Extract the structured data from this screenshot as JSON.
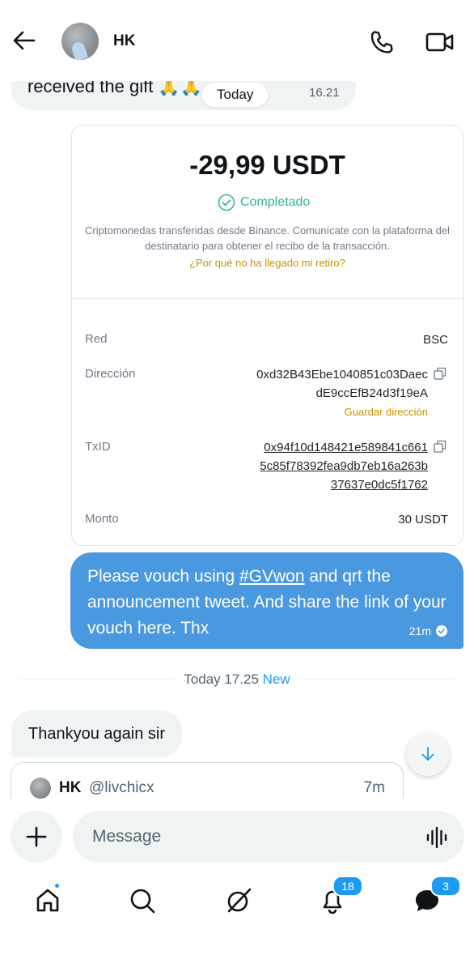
{
  "header": {
    "contact_name": "HK"
  },
  "previous_message": {
    "text": "received the gift 🙏🙏",
    "time": "16.21"
  },
  "today_pill": "Today",
  "transaction": {
    "amount": "-29,99 USDT",
    "status": "Completado",
    "description": "Criptomonedas transferidas desde Binance. Comunícate con la plataforma del destinatario para obtener el recibo de la transacción.",
    "help_link": "¿Por qué no ha llegado mi retiro?",
    "network_label": "Red",
    "network_value": "BSC",
    "address_label": "Dirección",
    "address_line1": "0xd32B43Ebe1040851c03Daec",
    "address_line2": "dE9ccEfB24d3f19eA",
    "save_address": "Guardar dirección",
    "txid_label": "TxID",
    "txid_line1": "0x94f10d148421e589841c661",
    "txid_line2": "5c85f78392fea9db7eb16a263b",
    "txid_line3": "37637e0dc5f1762",
    "amount_label": "Monto",
    "amount_value": "30 USDT"
  },
  "outgoing_message": {
    "text_before": "Please vouch using ",
    "hashtag": "#GVwon",
    "text_after": " and qrt the announcement tweet. And share the link of your vouch here. Thx",
    "time": "21m"
  },
  "date_divider": {
    "label": "Today 17.25",
    "new_label": "New"
  },
  "incoming_message": {
    "text": "Thankyou again sir"
  },
  "quoted_post": {
    "name": "HK",
    "handle": "@livchicx",
    "time": "7m"
  },
  "composer": {
    "placeholder": "Message"
  },
  "nav": {
    "notifications_badge": "18",
    "messages_badge": "3"
  },
  "colors": {
    "accent": "#1d9bf0",
    "outgoing_bubble": "#4a98e0",
    "success": "#2ebd85",
    "binance_gold": "#c99400"
  }
}
